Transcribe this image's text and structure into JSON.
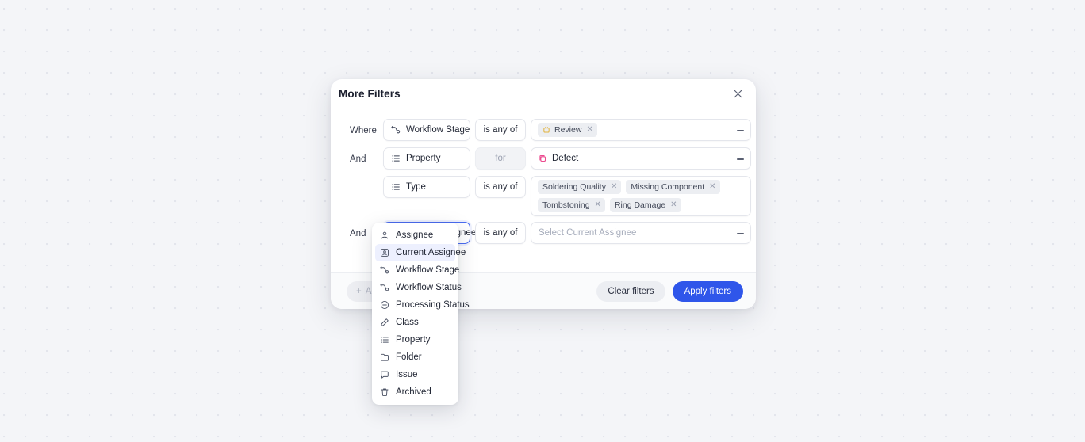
{
  "modal": {
    "title": "More Filters",
    "close_icon": "close-icon"
  },
  "rows": [
    {
      "conjunction": "Where",
      "field": "Workflow Stage",
      "field_icon": "workflow-icon",
      "operator": "is any of",
      "operator_disabled": false,
      "values": [
        {
          "label": "Review",
          "icon": "stage-badge-icon",
          "color": "#e2b33c",
          "removable": true
        }
      ],
      "placeholder": "",
      "removable": true
    },
    {
      "conjunction": "And",
      "field": "Property",
      "field_icon": "list-icon",
      "operator": "for",
      "operator_disabled": true,
      "inline_value": {
        "label": "Defect",
        "icon": "defect-icon",
        "color": "#ec4b8f"
      },
      "removable": true
    },
    {
      "conjunction": "",
      "field": "Type",
      "field_icon": "list-icon",
      "operator": "is any of",
      "operator_disabled": false,
      "values": [
        {
          "label": "Soldering Quality",
          "removable": true
        },
        {
          "label": "Missing Component",
          "removable": true
        },
        {
          "label": "Tombstoning",
          "removable": true
        },
        {
          "label": "Ring Damage",
          "removable": true
        }
      ],
      "removable": false
    },
    {
      "conjunction": "And",
      "field": "Current Assignee",
      "field_icon": "current-assignee-icon",
      "operator": "is any of",
      "operator_disabled": false,
      "values": [],
      "placeholder": "Select Current Assignee",
      "removable": true,
      "focused": true
    }
  ],
  "dropdown": {
    "items": [
      {
        "label": "Assignee",
        "icon": "assignee-icon",
        "selected": false
      },
      {
        "label": "Current Assignee",
        "icon": "current-assignee-icon",
        "selected": true
      },
      {
        "label": "Workflow Stage",
        "icon": "workflow-icon",
        "selected": false
      },
      {
        "label": "Workflow Status",
        "icon": "workflow-icon",
        "selected": false
      },
      {
        "label": "Processing Status",
        "icon": "minus-circle-icon",
        "selected": false
      },
      {
        "label": "Class",
        "icon": "pencil-icon",
        "selected": false
      },
      {
        "label": "Property",
        "icon": "list-icon",
        "selected": false
      },
      {
        "label": "Folder",
        "icon": "folder-icon",
        "selected": false
      },
      {
        "label": "Issue",
        "icon": "chat-icon",
        "selected": false
      },
      {
        "label": "Archived",
        "icon": "trash-icon",
        "selected": false
      }
    ]
  },
  "footer": {
    "add_label": "Add",
    "add_icon": "plus-icon",
    "clear_label": "Clear filters",
    "apply_label": "Apply filters"
  },
  "colors": {
    "accent": "#2f56ea",
    "chip_bg": "#eceef2",
    "selected_bg": "#edf0fe",
    "focus_border": "#4a6cf0",
    "page_bg": "#f4f5f8"
  }
}
